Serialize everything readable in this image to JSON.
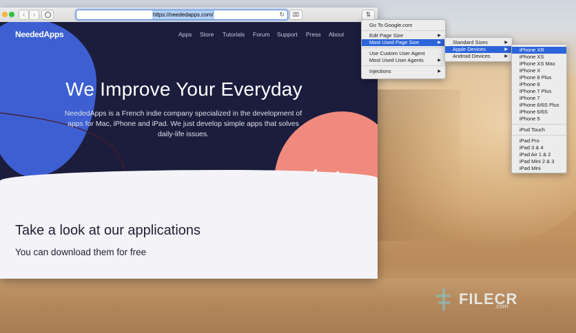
{
  "browser": {
    "url": "https://neededapps.com/",
    "back_glyph": "‹",
    "forward_glyph": "›",
    "reload_glyph": "↻",
    "camera_glyph": "⌧",
    "extension_glyph": "⇅"
  },
  "site": {
    "brand": "NeededApps",
    "nav": [
      "Apps",
      "Store",
      "Tutorials",
      "Forum",
      "Support",
      "Press",
      "About"
    ],
    "hero_title": "We Improve Your Everyday",
    "hero_subtitle": "NeededApps is a French indie company specialized in the development of apps for Mac, iPhone and iPad. We just develop simple apps that solves daily-life issues.",
    "section_title": "Take a look at our applications",
    "section_subtitle": "You can download them for free"
  },
  "menu_main": {
    "items": [
      {
        "label": "Go To Google.com"
      },
      {
        "label": "Edit Page Size",
        "submenu": true
      },
      {
        "label": "Most Used Page Size",
        "submenu": true,
        "selected": true
      },
      {
        "label": "Use Custom User Agent"
      },
      {
        "label": "Most Used User Agents",
        "submenu": true
      },
      {
        "label": "Injections",
        "submenu": true
      }
    ]
  },
  "menu_sizes": {
    "items": [
      {
        "label": "Standard Sizes",
        "submenu": true
      },
      {
        "label": "Apple Devices",
        "submenu": true,
        "selected": true
      },
      {
        "label": "Android Devices",
        "submenu": true
      }
    ]
  },
  "menu_apple": {
    "items": [
      {
        "label": "iPhone XR",
        "selected": true
      },
      {
        "label": "iPhone XS"
      },
      {
        "label": "iPhone XS Max"
      },
      {
        "label": "iPhone X"
      },
      {
        "label": "iPhone 8 Plus"
      },
      {
        "label": "iPhone 8"
      },
      {
        "label": "iPhone 7 Plus"
      },
      {
        "label": "iPhone 7"
      },
      {
        "label": "iPhone 6/6S Plus"
      },
      {
        "label": "iPhone 6/6S"
      },
      {
        "label": "iPhone 5"
      },
      {
        "label": "iPod Touch"
      },
      {
        "label": "iPad Pro"
      },
      {
        "label": "iPad 3 & 4"
      },
      {
        "label": "iPad Air 1 & 2"
      },
      {
        "label": "iPad Mini 2 & 3"
      },
      {
        "label": "iPad Mini"
      }
    ]
  },
  "watermark": {
    "text": "FILECR",
    "suffix": ".com"
  },
  "colors": {
    "hero_bg": "#1c1d3d",
    "blob_blue": "#3d5fd1",
    "blob_pink": "#f08a7e",
    "menu_highlight": "#2c64d9"
  }
}
